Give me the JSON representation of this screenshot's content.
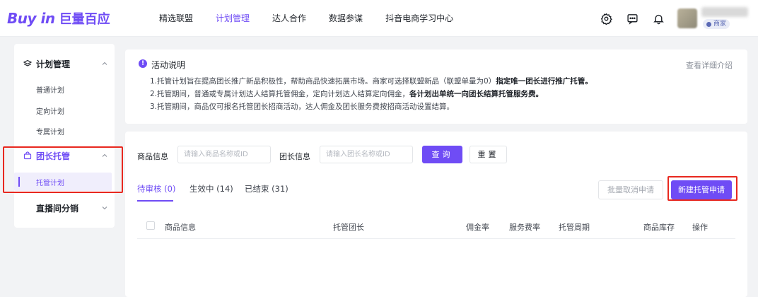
{
  "brand": {
    "logo_text": "Buy in",
    "logo_sub": "巨量百应"
  },
  "topnav": {
    "items": [
      {
        "label": "精选联盟",
        "active": false
      },
      {
        "label": "计划管理",
        "active": true
      },
      {
        "label": "达人合作",
        "active": false
      },
      {
        "label": "数据参谋",
        "active": false
      },
      {
        "label": "抖音电商学习中心",
        "active": false
      }
    ],
    "icons": [
      "settings-icon",
      "message-icon",
      "bell-icon"
    ],
    "shop_badge": "商家"
  },
  "sidebar": {
    "groups": [
      {
        "label": "计划管理",
        "icon": "layers-icon",
        "expanded": true,
        "items": [
          "普通计划",
          "定向计划",
          "专属计划"
        ]
      },
      {
        "label": "团长托管",
        "icon": "shopping-bag-icon",
        "expanded": true,
        "highlighted": true,
        "items": [
          "托管计划"
        ],
        "active_item": "托管计划"
      },
      {
        "label": "直播间分销",
        "icon": "",
        "expanded": false,
        "items": []
      }
    ]
  },
  "notice": {
    "title": "活动说明",
    "more_link": "查看详细介绍",
    "line1_normal": "1.托管计划旨在提高团长推广新品积极性，帮助商品快速拓展市场。商家可选择联盟新品（联盟单量为0）",
    "line1_bold": "指定唯一团长进行推广托管。",
    "line2_normal": "2.托管期间，普通或专属计划达人结算托管佣金，定向计划达人结算定向佣金，",
    "line2_bold": "各计划出单统一向团长结算托管服务费。",
    "line3": "3.托管期间，商品仅可报名托管团长招商活动，达人佣金及团长服务费按招商活动设置结算。"
  },
  "filters": {
    "product_label": "商品信息",
    "product_placeholder": "请输入商品名称或ID",
    "leader_label": "团长信息",
    "leader_placeholder": "请输入团长名称或ID",
    "query_button": "查询",
    "reset_button": "重置"
  },
  "tabs": [
    {
      "label": "待审核 (0)",
      "active": true
    },
    {
      "label": "生效中 (14)",
      "active": false
    },
    {
      "label": "已结束 (31)",
      "active": false
    }
  ],
  "actions": {
    "batch_cancel": "批量取消申请",
    "new_request": "新建托管申请"
  },
  "table": {
    "columns": [
      "商品信息",
      "托管团长",
      "佣金率",
      "服务费率",
      "托管周期",
      "商品库存",
      "操作"
    ]
  },
  "colors": {
    "accent": "#6f4cf5",
    "highlight_border": "#e8281f"
  }
}
